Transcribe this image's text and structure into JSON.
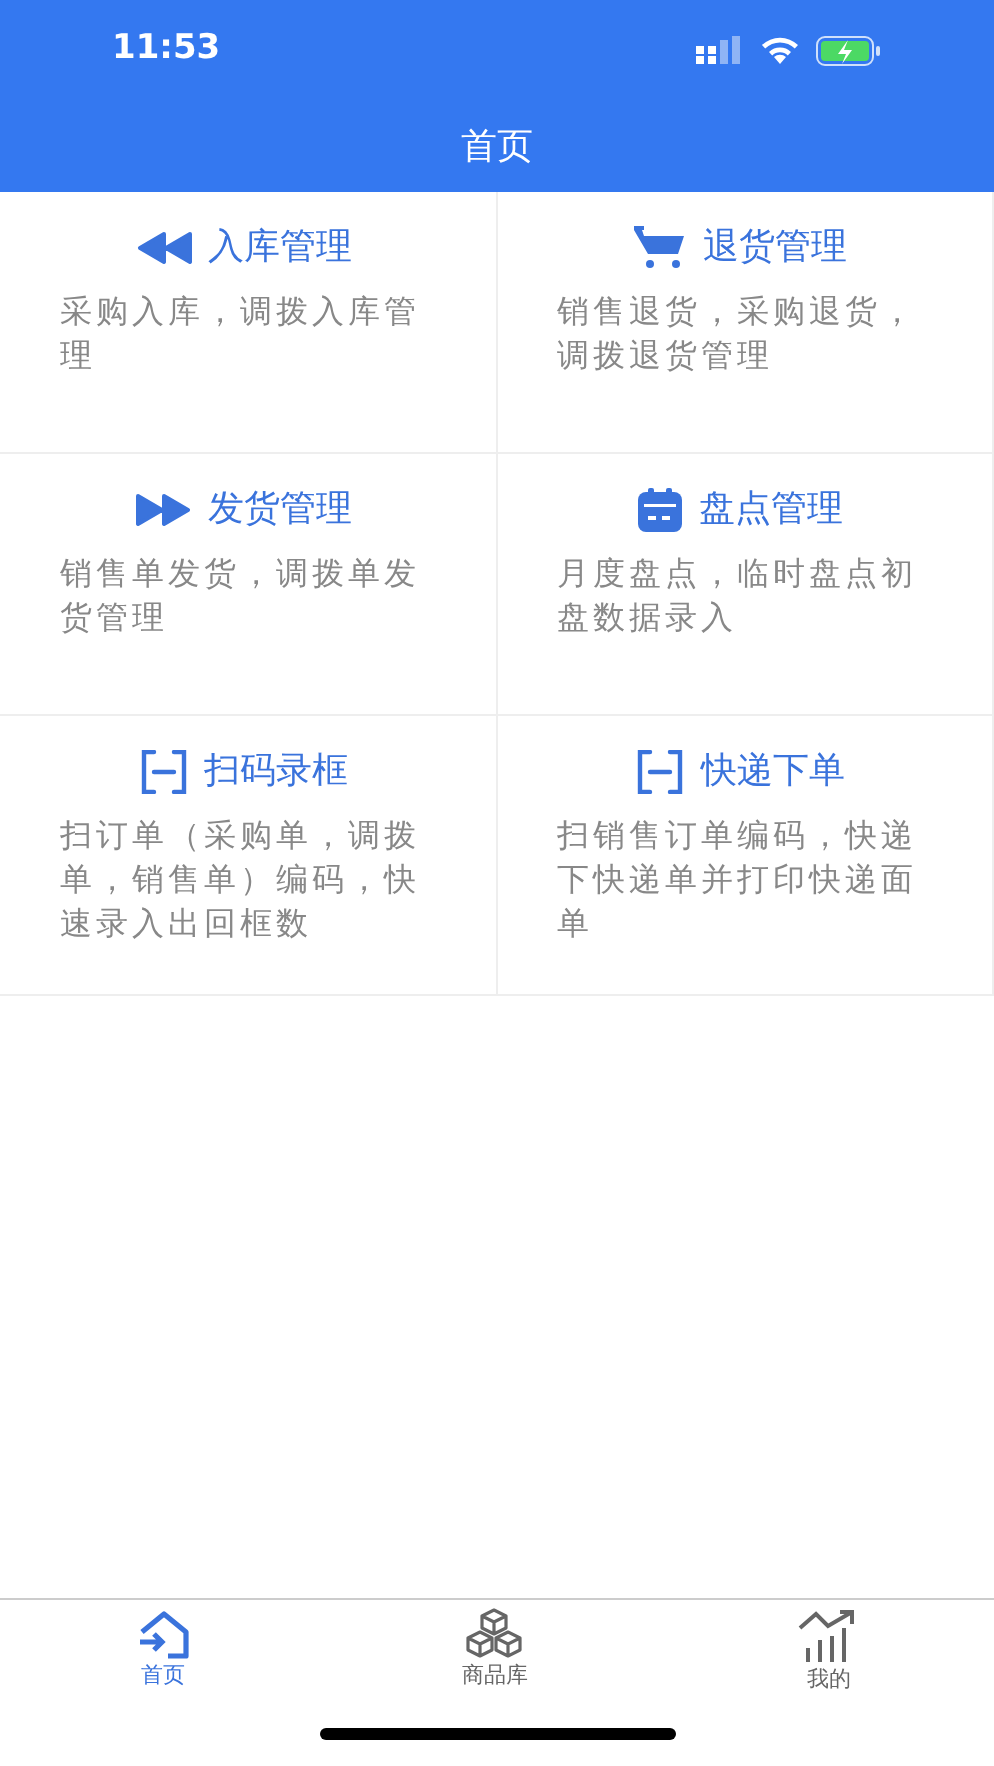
{
  "status_bar": {
    "time": "11:53"
  },
  "nav_bar": {
    "title": "首页"
  },
  "tiles": [
    {
      "kind": "rewind",
      "title": "入库管理",
      "description": "采购入库，调拨入库管理"
    },
    {
      "kind": "cart",
      "title": "退货管理",
      "description": "销售退货，采购退货，调拨退货管理"
    },
    {
      "kind": "forward",
      "title": "发货管理",
      "description": "销售单发货，调拨单发货管理"
    },
    {
      "kind": "calendar",
      "title": "盘点管理",
      "description": "月度盘点，临时盘点初盘数据录入"
    },
    {
      "kind": "scan",
      "title": "扫码录框",
      "description": "扫订单（采购单，调拨单，销售单）编码，快速录入出回框数"
    },
    {
      "kind": "scan",
      "title": "快递下单",
      "description": "扫销售订单编码，快递下快递单并打印快递面单"
    }
  ],
  "tab_bar": [
    {
      "kind": "home",
      "label": "首页",
      "selected": true
    },
    {
      "kind": "cubes",
      "label": "商品库",
      "selected": false
    },
    {
      "kind": "chart",
      "label": "我的",
      "selected": false
    }
  ]
}
